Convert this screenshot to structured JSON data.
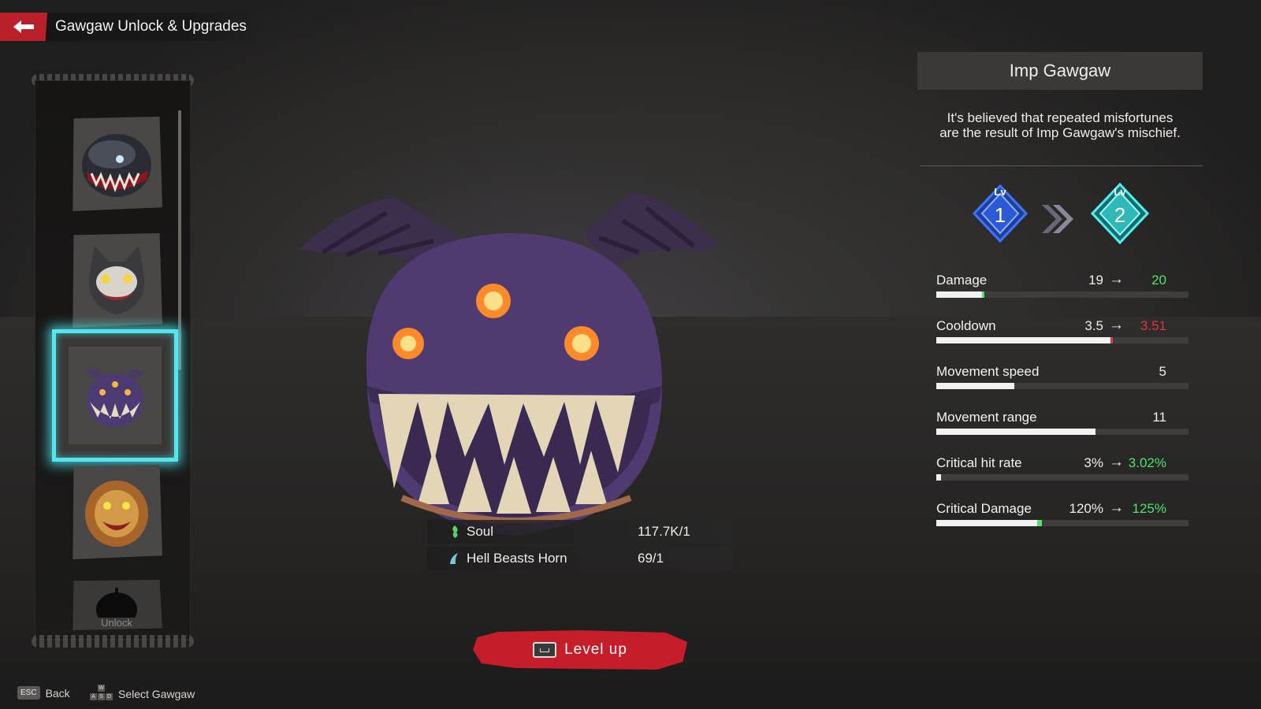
{
  "header": {
    "title": "Gawgaw Unlock & Upgrades"
  },
  "gawgaw_list": {
    "slots": [
      {
        "name": "Dark sphere gawgaw"
      },
      {
        "name": "Cat gawgaw"
      },
      {
        "name": "Imp Gawgaw",
        "selected": true
      },
      {
        "name": "Lion gawgaw"
      },
      {
        "name": "Locked gawgaw",
        "label": "Unlock"
      }
    ]
  },
  "materials": [
    {
      "icon": "soul-icon",
      "name": "Soul",
      "count": "117.7K/1"
    },
    {
      "icon": "horn-icon",
      "name": "Hell Beasts Horn",
      "count": "69/1"
    }
  ],
  "level_up": {
    "label": "Level up",
    "key": "space"
  },
  "footer": {
    "back_key": "ESC",
    "back_label": "Back",
    "select_keys": [
      "W",
      "A",
      "S",
      "D"
    ],
    "select_label": "Select Gawgaw"
  },
  "info": {
    "name": "Imp Gawgaw",
    "description_line1": "It's believed that repeated misfortunes",
    "description_line2": "are the result of Imp Gawgaw's mischief.",
    "level_prefix": "Lv",
    "current_level": "1",
    "next_level": "2"
  },
  "stats": [
    {
      "label": "Damage",
      "current": "19",
      "next": "20",
      "change": "up",
      "fill": 0.18,
      "delta": 0.01
    },
    {
      "label": "Cooldown",
      "current": "3.5",
      "next": "3.51",
      "change": "down",
      "fill": 0.69,
      "delta": 0.01
    },
    {
      "label": "Movement speed",
      "current": "5",
      "fill": 0.31
    },
    {
      "label": "Movement range",
      "current": "11",
      "fill": 0.63
    },
    {
      "label": "Critical hit rate",
      "current": "3%",
      "next": "3.02%",
      "change": "up",
      "fill": 0.02,
      "delta": 0.0
    },
    {
      "label": "Critical Damage",
      "current": "120%",
      "next": "125%",
      "change": "up",
      "fill": 0.4,
      "delta": 0.02
    }
  ],
  "colors": {
    "accent_red": "#c51d2a",
    "selection_cyan": "#52e6ef",
    "increase_green": "#4fe36a",
    "decrease_red": "#e0363f",
    "lv1_blue": "#2c5ad6",
    "lv2_teal": "#2fd3d0"
  },
  "arrow_symbol": "→"
}
